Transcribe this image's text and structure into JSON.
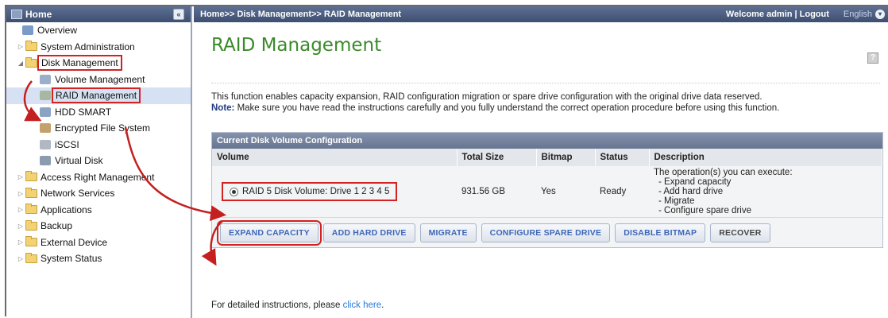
{
  "sidebar": {
    "title": "Home",
    "collapse_label": "«",
    "items": [
      {
        "label": "Overview",
        "icon": "overview-icon"
      },
      {
        "label": "System Administration",
        "icon": "folder-icon"
      },
      {
        "label": "Disk Management",
        "icon": "folder-open-icon"
      },
      {
        "label": "Volume Management",
        "icon": "volume-icon"
      },
      {
        "label": "RAID Management",
        "icon": "raid-icon"
      },
      {
        "label": "HDD SMART",
        "icon": "hdd-icon"
      },
      {
        "label": "Encrypted File System",
        "icon": "encrypt-icon"
      },
      {
        "label": "iSCSI",
        "icon": "iscsi-icon"
      },
      {
        "label": "Virtual Disk",
        "icon": "virtual-disk-icon"
      },
      {
        "label": "Access Right Management",
        "icon": "folder-icon"
      },
      {
        "label": "Network Services",
        "icon": "folder-icon"
      },
      {
        "label": "Applications",
        "icon": "folder-icon"
      },
      {
        "label": "Backup",
        "icon": "folder-icon"
      },
      {
        "label": "External Device",
        "icon": "folder-icon"
      },
      {
        "label": "System Status",
        "icon": "folder-icon"
      }
    ]
  },
  "header": {
    "breadcrumb": "Home>> Disk Management>> RAID Management",
    "welcome": "Welcome admin | Logout",
    "language": "English"
  },
  "main": {
    "title": "RAID Management",
    "description": "This function enables capacity expansion, RAID configuration migration or spare drive configuration with the original drive data reserved.",
    "note_label": "Note:",
    "note_text": " Make sure you have read the instructions carefully and you fully understand the correct operation procedure before using this function.",
    "table": {
      "caption": "Current Disk Volume Configuration",
      "columns": [
        "Volume",
        "Total Size",
        "Bitmap",
        "Status",
        "Description"
      ],
      "row": {
        "volume": "RAID 5 Disk Volume: Drive  1 2 3 4 5",
        "total_size": "931.56 GB",
        "bitmap": "Yes",
        "status": "Ready",
        "description_lines": [
          "The operation(s) you can execute:",
          "- Expand capacity",
          "- Add hard drive",
          "- Migrate",
          "- Configure spare drive"
        ]
      }
    },
    "buttons": {
      "expand": "EXPAND CAPACITY",
      "add": "ADD HARD DRIVE",
      "migrate": "MIGRATE",
      "spare": "CONFIGURE SPARE DRIVE",
      "bitmap": "DISABLE BITMAP",
      "recover": "RECOVER"
    },
    "footer_text": "For detailed instructions, please ",
    "footer_link": "click here",
    "footer_end": "."
  },
  "colors": {
    "title_green": "#3b8a2a",
    "highlight_red": "#d32222",
    "header_blue": "#3e4f72",
    "link_blue": "#2a7bd6"
  }
}
